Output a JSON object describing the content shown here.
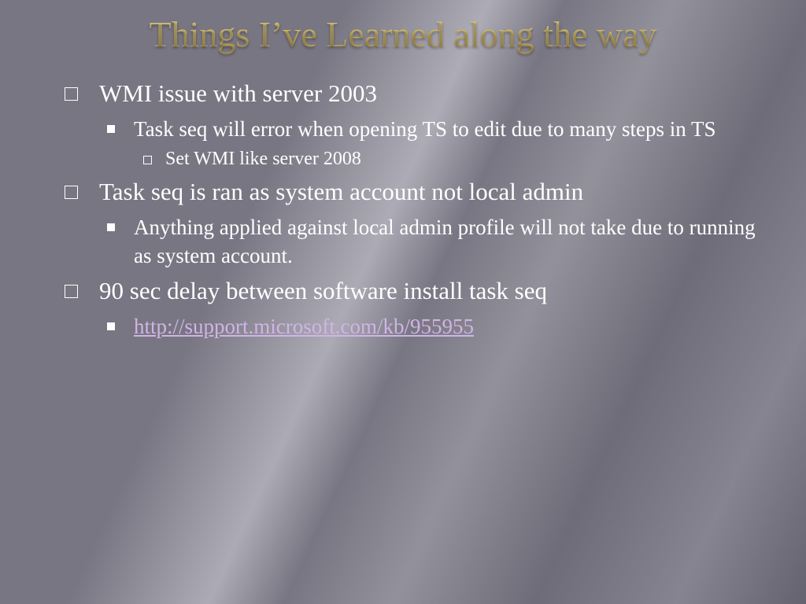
{
  "title": "Things I’ve Learned along the way",
  "bullets": [
    {
      "text": "WMI issue with server 2003",
      "children": [
        {
          "text": "Task seq will error when opening TS to edit due to many steps in TS",
          "children": [
            {
              "text": "Set WMI like server 2008"
            }
          ]
        }
      ]
    },
    {
      "text": "Task seq is ran as system account not local admin",
      "children": [
        {
          "text": "Anything applied against local admin profile will not take due to running as system account."
        }
      ]
    },
    {
      "text": "90 sec delay between software install task seq",
      "children": [
        {
          "link": "http://support.microsoft.com/kb/955955"
        }
      ]
    }
  ]
}
